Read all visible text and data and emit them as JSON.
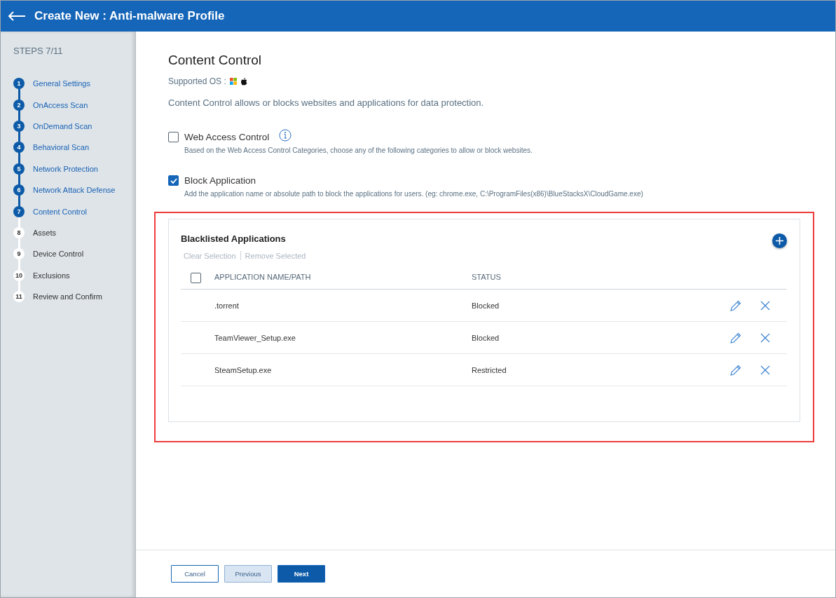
{
  "header": {
    "title": "Create New : Anti-malware Profile"
  },
  "sidebar": {
    "steps_label": "STEPS 7/11",
    "steps": [
      {
        "number": "1",
        "label": "General Settings",
        "completed": true
      },
      {
        "number": "2",
        "label": "OnAccess Scan",
        "completed": true
      },
      {
        "number": "3",
        "label": "OnDemand Scan",
        "completed": true
      },
      {
        "number": "4",
        "label": "Behavioral Scan",
        "completed": true
      },
      {
        "number": "5",
        "label": "Network Protection",
        "completed": true
      },
      {
        "number": "6",
        "label": "Network Attack Defense",
        "completed": true
      },
      {
        "number": "7",
        "label": "Content Control",
        "completed": true
      },
      {
        "number": "8",
        "label": "Assets",
        "completed": false
      },
      {
        "number": "9",
        "label": "Device Control",
        "completed": false
      },
      {
        "number": "10",
        "label": "Exclusions",
        "completed": false
      },
      {
        "number": "11",
        "label": "Review and Confirm",
        "completed": false
      }
    ]
  },
  "content": {
    "title": "Content Control",
    "supported_os_label": "Supported OS :",
    "description": "Content Control allows or blocks websites and applications for data protection.",
    "options": [
      {
        "label": "Web Access Control",
        "checked": false,
        "info": true,
        "hint": "Based on the Web Access Control Categories, choose any of the following categories to allow or block websites."
      },
      {
        "label": "Block Application",
        "checked": true,
        "info": false,
        "hint": "Add the application name or absolute path to block the applications for users. (eg: chrome.exe, C:\\ProgramFiles(x86)\\BlueStacksX\\CloudGame.exe)"
      }
    ],
    "panel": {
      "title": "Blacklisted Applications",
      "actions": [
        "Clear Selection",
        "Remove Selected"
      ],
      "select_all_checked": false,
      "columns": [
        "APPLICATION NAME/PATH",
        "STATUS"
      ],
      "rows": [
        {
          "name": ".torrent",
          "status": "Blocked"
        },
        {
          "name": "TeamViewer_Setup.exe",
          "status": "Blocked"
        },
        {
          "name": "SteamSetup.exe",
          "status": "Restricted"
        }
      ]
    }
  },
  "footer": {
    "buttons": [
      {
        "label": "Cancel",
        "kind": "outline"
      },
      {
        "label": "Previous",
        "kind": "secondary"
      },
      {
        "label": "Next",
        "kind": "primary"
      }
    ]
  }
}
